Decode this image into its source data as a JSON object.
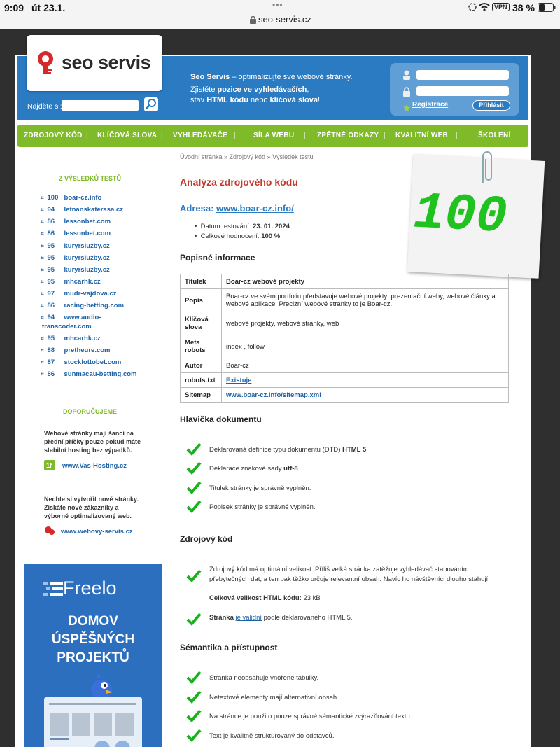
{
  "status": {
    "time": "9:09",
    "date": "út 23.1.",
    "url": "seo-servis.cz",
    "vpn": "VPN",
    "battery": "38 %",
    "dots": "•••"
  },
  "header": {
    "logo_text": "seo servis",
    "search_label": "Najděte si:",
    "tagline_1a": "Seo Servis",
    "tagline_1b": " – optimalizujte své webové stránky.",
    "tagline_2a": "Zjistěte ",
    "tagline_2b": "pozice ve vyhledávačích",
    "tagline_2c": ",",
    "tagline_3a": "stav ",
    "tagline_3b": "HTML kódu",
    "tagline_3c": " nebo ",
    "tagline_3d": "klíčová slova",
    "tagline_3e": "!",
    "register": "Registrace",
    "login": "Přihlásit"
  },
  "nav": [
    "ZDROJOVÝ KÓD",
    "KLÍČOVÁ SLOVA",
    "VYHLEDÁVAČE",
    "SÍLA WEBU",
    "ZPĚTNÉ ODKAZY",
    "KVALITNÍ WEB",
    "ŠKOLENÍ"
  ],
  "sidebar": {
    "results_title": "Z VÝSLEDKŮ TESTŮ",
    "results": [
      {
        "score": "100",
        "site": "boar-cz.info"
      },
      {
        "score": "94",
        "site": "letnanskaterasa.cz"
      },
      {
        "score": "86",
        "site": "lessonbet.com"
      },
      {
        "score": "86",
        "site": "lessonbet.com"
      },
      {
        "score": "95",
        "site": "kuryrsluzby.cz"
      },
      {
        "score": "95",
        "site": "kuryrsluzby.cz"
      },
      {
        "score": "95",
        "site": "kuryrsluzby.cz"
      },
      {
        "score": "95",
        "site": "mhcarhk.cz"
      },
      {
        "score": "97",
        "site": "mudr-vajdova.cz"
      },
      {
        "score": "86",
        "site": "racing-betting.com"
      },
      {
        "score": "94",
        "site": "www.audio-"
      },
      {
        "score": "95",
        "site": "mhcarhk.cz"
      },
      {
        "score": "88",
        "site": "pretheure.com"
      },
      {
        "score": "87",
        "site": "stocklottobet.com"
      },
      {
        "score": "86",
        "site": "sunmacau-betting.com"
      }
    ],
    "results_wrap": "transcoder.com",
    "recommend_title": "DOPORUČUJEME",
    "rec1": [
      "Webové stránky mají šanci na",
      "přední příčky pouze pokud máte",
      "stabilní hosting bez výpadků."
    ],
    "rec1_link": "www.Vas-Hosting.cz",
    "rec2": [
      "Nechte si vytvořit nové stránky.",
      "Získáte nové zákazníky a",
      "výborně optimalizovaný web."
    ],
    "rec2_link": "www.webovy-servis.cz",
    "ad": {
      "brand": "Freelo",
      "l1": "DOMOV",
      "l2": "ÚSPĚŠNÝCH",
      "l3": "PROJEKTŮ",
      "bg": "#2c6fbf"
    }
  },
  "main": {
    "breadcrumb": "Úvodní stránka » Zdrojový kód » Výsledek testu",
    "title": "Analýza zdrojového kódu",
    "address_label": "Adresa: ",
    "address_link": "www.boar-cz.info/",
    "date_label": "Datum testování: ",
    "date_value": "23. 01. 2024",
    "rating_label": "Celkové hodnocení: ",
    "rating_value": "100 %",
    "score": "100",
    "desc_title": "Popisné informace",
    "table": [
      {
        "k": "Titulek",
        "v": "Boar-cz webové projekty",
        "bold": true
      },
      {
        "k": "Popis",
        "v": "Boar-cz ve svém portfoliu představuje webové projekty: prezentační weby, webové články a webové aplikace. Precizní webové stránky to je Boar-cz."
      },
      {
        "k": "Klíčová slova",
        "v": "webové projekty, webové stránky, web"
      },
      {
        "k": "Meta robots",
        "v": "index , follow"
      },
      {
        "k": "Autor",
        "v": "Boar-cz"
      },
      {
        "k": "robots.txt",
        "v": "Existuje",
        "link": true
      },
      {
        "k": "Sitemap",
        "v": "www.boar-cz.info/sitemap.xml",
        "link": true
      }
    ],
    "head_title": "Hlavička dokumentu",
    "head_items": [
      [
        "Deklarovaná definice typu dokumentu (DTD) ",
        "HTML 5",
        "."
      ],
      [
        "Deklarace znakové sady ",
        "utf-8",
        "."
      ],
      [
        "Titulek stránky je správně vyplněn.",
        "",
        ""
      ],
      [
        "Popisek stránky je správně vyplněn.",
        "",
        ""
      ]
    ],
    "src_title": "Zdrojový kód",
    "src_p1": "Zdrojový kód má optimální velikost. Příliš velká stránka zatěžuje vyhledávač stahováním",
    "src_p2": "přebytečných dat, a ten pak těžko určuje relevantní obsah. Navíc ho návštěvníci dlouho stahují.",
    "src_size_label": "Celková velikost HTML kódu: ",
    "src_size": "23 kB",
    "src_valid_a": "Stránka ",
    "src_valid_link": "je validní",
    "src_valid_b": " podle deklarovaného HTML 5.",
    "sem_title": "Sémantika a přístupnost",
    "sem_items": [
      "Stránka neobsahuje vnořené tabulky.",
      "Netextové elementy mají alternativní obsah.",
      "Na stránce je použito pouze správné sémantické zvýrazňování textu.",
      "Text je kvalitně strukturovaný do odstavců."
    ]
  },
  "colors": {
    "blue": "#2a7bc2",
    "green": "#7fba28",
    "red": "#c0392b",
    "score_green": "#1fc21f"
  }
}
